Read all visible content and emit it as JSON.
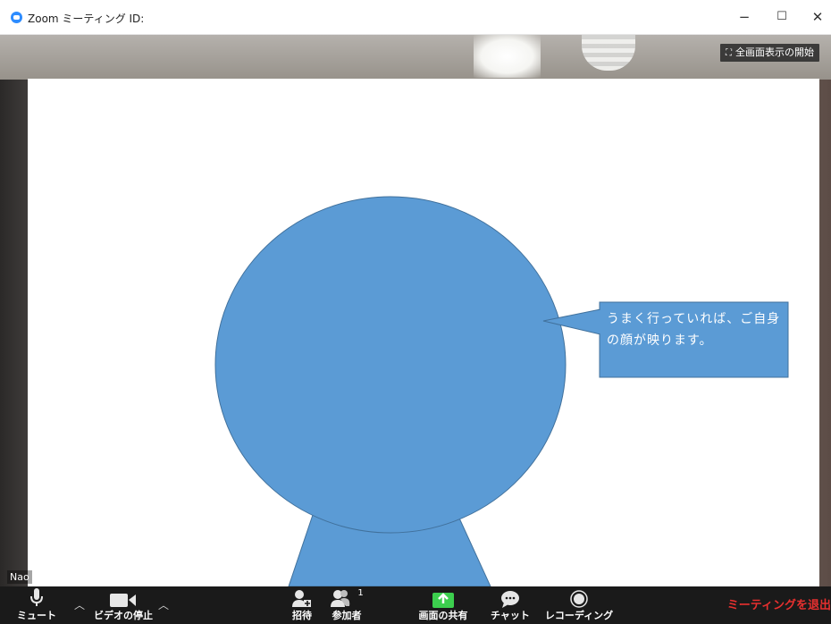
{
  "window": {
    "title": "Zoom ミーティング ID:",
    "minimize": "−",
    "maximize": "☐",
    "close": "✕"
  },
  "video": {
    "fullscreen_label": "全画面表示の開始",
    "participant_name": "Nao"
  },
  "slide": {
    "callout_text": "うまく行っていれば、ご自身の顔が映ります。",
    "shape_fill": "#5b9bd5",
    "shape_stroke": "#41719c"
  },
  "toolbar": {
    "mute": "ミュート",
    "stop_video": "ビデオの停止",
    "invite": "招待",
    "participants": "参加者",
    "participant_count": "1",
    "share_screen": "画面の共有",
    "chat": "チャット",
    "record": "レコーディング",
    "leave": "ミーティングを退出"
  },
  "colors": {
    "toolbar_bg": "#1a1a1a",
    "share_green": "#3ccf4e",
    "leave_red": "#e8302f"
  }
}
